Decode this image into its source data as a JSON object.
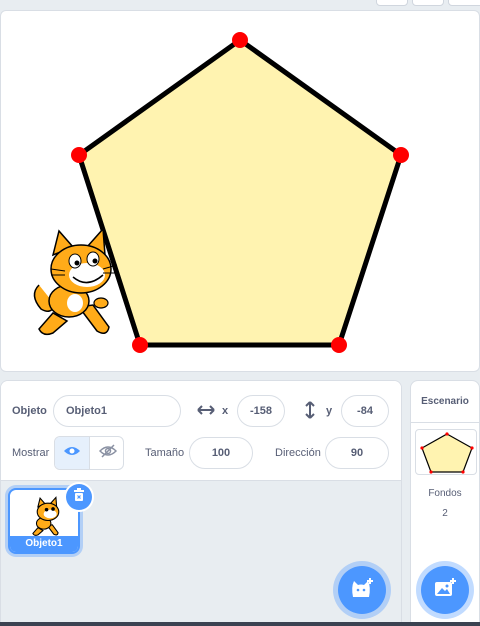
{
  "sprite_info": {
    "sprite_label": "Objeto",
    "sprite_name": "Objeto1",
    "x_label": "x",
    "x_value": "-158",
    "y_label": "y",
    "y_value": "-84",
    "show_label": "Mostrar",
    "size_label": "Tamaño",
    "size_value": "100",
    "direction_label": "Dirección",
    "direction_value": "90"
  },
  "sprite_list": {
    "items": [
      {
        "name": "Objeto1",
        "selected": true
      }
    ]
  },
  "stage_selector": {
    "title": "Escenario",
    "backdrops_label": "Fondos",
    "backdrops_count": "2"
  },
  "colors": {
    "accent": "#4c97ff",
    "polygon_fill": "#fff3b0",
    "vertex": "#ff0000",
    "cat_orange": "#ffab19"
  },
  "icons": {
    "x_axis": "horizontal-arrow-icon",
    "y_axis": "vertical-arrow-icon",
    "show": "eye-icon",
    "hide": "eye-slash-icon",
    "delete": "trash-icon",
    "add_sprite": "cat-add-icon",
    "add_backdrop": "image-add-icon"
  }
}
